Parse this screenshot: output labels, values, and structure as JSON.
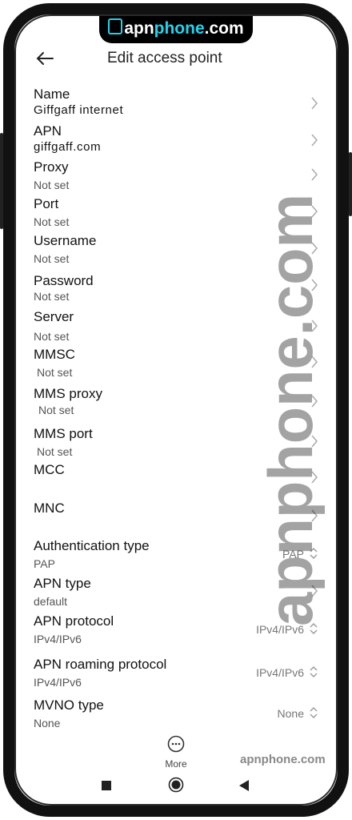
{
  "banner": {
    "brand_a": "apn",
    "brand_b": "phone",
    "brand_c": ".com"
  },
  "header": {
    "title": "Edit access point"
  },
  "fields": [
    {
      "label": "Name",
      "value": "Giffgaff internet"
    },
    {
      "label": "APN",
      "value": "giffgaff.com"
    },
    {
      "label": "Proxy",
      "value": "Not set"
    },
    {
      "label": "Port",
      "value": "Not set"
    },
    {
      "label": "Username",
      "value": "Not set"
    },
    {
      "label": "Password",
      "value": "Not set"
    },
    {
      "label": "Server",
      "value": "Not set"
    },
    {
      "label": "MMSC",
      "value": "Not set"
    },
    {
      "label": "MMS proxy",
      "value": "Not set"
    },
    {
      "label": "MMS port",
      "value": "Not set"
    },
    {
      "label": "MCC",
      "value": ""
    },
    {
      "label": "MNC",
      "value": ""
    },
    {
      "label": "Authentication type",
      "value": "PAP",
      "selected": "PAP"
    },
    {
      "label": "APN type",
      "value": "default"
    },
    {
      "label": "APN protocol",
      "value": "IPv4/IPv6",
      "selected": "IPv4/IPv6"
    },
    {
      "label": "APN roaming protocol",
      "value": "IPv4/IPv6",
      "selected": "IPv4/IPv6"
    },
    {
      "label": "MVNO type",
      "value": "None",
      "selected": "None"
    }
  ],
  "watermark": {
    "text": "apnphone.com"
  },
  "more": {
    "label": "More"
  },
  "icons": {
    "back": "back-arrow-icon",
    "more": "more-dots-icon",
    "nav": [
      "recents-square-icon",
      "home-circle-icon",
      "back-triangle-icon"
    ]
  },
  "colors": {
    "accent": "#22d3ee",
    "frame": "#111111"
  }
}
